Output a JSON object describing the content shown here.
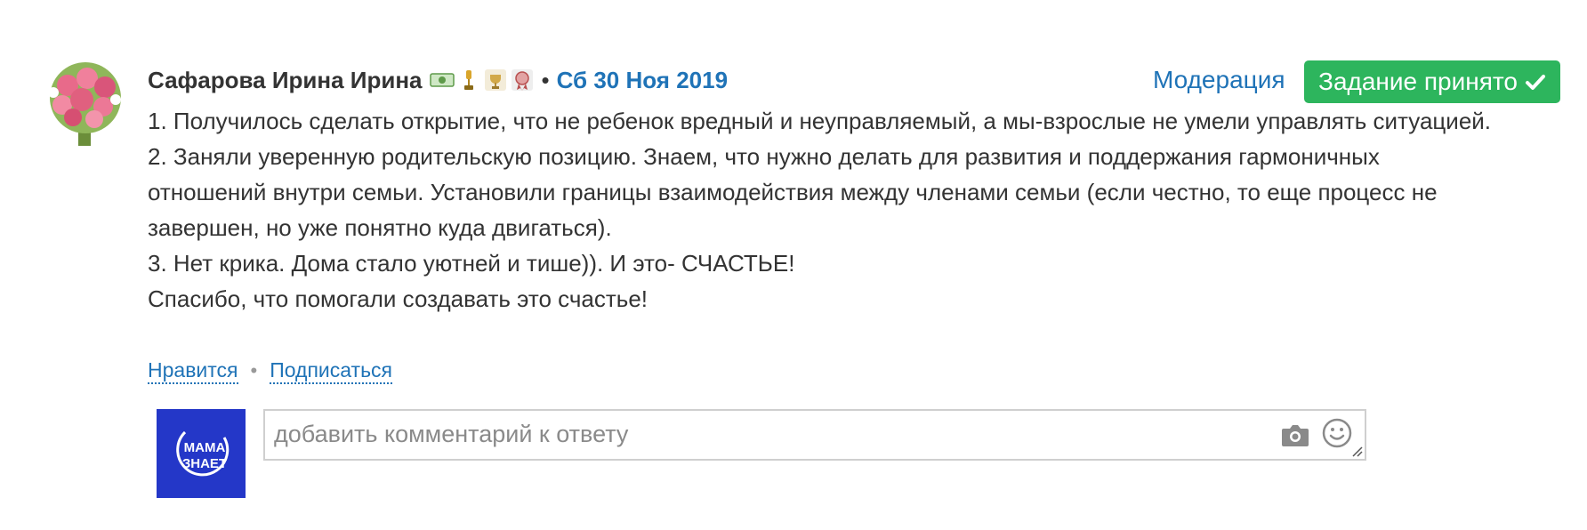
{
  "author": {
    "name": "Сафарова Ирина Ирина",
    "badges": [
      "money-badge-icon",
      "trophy-badge-icon",
      "cup-badge-icon",
      "medal-badge-icon"
    ]
  },
  "separator": "•",
  "date": "Сб 30 Ноя 2019",
  "moderation_label": "Модерация",
  "status_label": "Задание принято",
  "body_lines": [
    "1. Получилось сделать открытие, что не ребенок вредный и неуправляемый, а мы-взрослые не умели управлять ситуацией.",
    "2. Заняли уверенную родительскую позицию. Знаем, что нужно делать для развития и поддержания гармоничных",
    "отношений внутри семьи. Установили границы взаимодействия между членами семьи (если честно, то еще процесс не",
    "завершен, но уже понятно куда двигаться).",
    "3. Нет крика. Дома стало уютней и тише)). И это- СЧАСТЬЕ!",
    "Спасибо, что помогали создавать это счастье!"
  ],
  "actions": {
    "like": "Нравится",
    "dot": "•",
    "subscribe": "Подписаться"
  },
  "comment": {
    "placeholder": "добавить комментарий к ответу",
    "value": ""
  },
  "brand": {
    "logo_line1": "МАМА",
    "logo_line2": "ЗНАЕТ"
  },
  "colors": {
    "link": "#1f73b7",
    "accepted_button": "#2db55d",
    "brand_blue": "#2437c8"
  }
}
